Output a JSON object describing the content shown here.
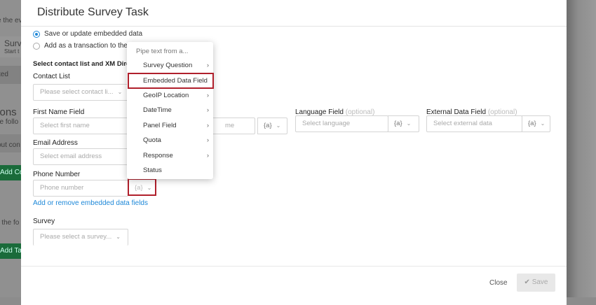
{
  "background": {
    "texts": [
      "e the ev",
      "Surv",
      "Start t",
      "ted",
      "tions",
      "he follo",
      "out con",
      "n the fo"
    ],
    "buttons": [
      "Add Con",
      "Add Tas"
    ]
  },
  "modal": {
    "title": "Distribute Survey Task",
    "radios": [
      {
        "label": "Save or update embedded data",
        "selected": true
      },
      {
        "label": "Add as a transaction to the c",
        "selected": false
      }
    ],
    "section_heading": "Select contact list and XM Direc",
    "contact_list": {
      "label": "Contact List",
      "placeholder": "Please select contact li..."
    },
    "first_name": {
      "label": "First Name Field",
      "placeholder": "Select first name"
    },
    "last_name": {
      "placeholder_partial": "me",
      "pipe": "{a}"
    },
    "language": {
      "label": "Language Field",
      "optional": "(optional)",
      "placeholder": "Select language",
      "pipe": "{a}"
    },
    "external": {
      "label": "External Data Field",
      "optional": "(optional)",
      "placeholder": "Select external data",
      "pipe": "{a}"
    },
    "email": {
      "label": "Email Address",
      "placeholder": "Select email address"
    },
    "phone": {
      "label": "Phone Number",
      "placeholder": "Phone number",
      "pipe": "{a}"
    },
    "embedded_link": "Add or remove embedded data fields",
    "survey": {
      "label": "Survey",
      "placeholder": "Please select a survey..."
    },
    "footer": {
      "close": "Close",
      "save": "Save"
    }
  },
  "pipe_menu": {
    "header": "Pipe text from a...",
    "items": [
      {
        "label": "Survey Question",
        "submenu": true
      },
      {
        "label": "Embedded Data Field",
        "submenu": false,
        "highlighted": true
      },
      {
        "label": "GeoIP Location",
        "submenu": true
      },
      {
        "label": "DateTime",
        "submenu": true
      },
      {
        "label": "Panel Field",
        "submenu": true
      },
      {
        "label": "Quota",
        "submenu": true
      },
      {
        "label": "Response",
        "submenu": true
      },
      {
        "label": "Status",
        "submenu": false
      }
    ]
  },
  "colors": {
    "accent": "#1e88d8",
    "highlight": "#b0202c",
    "green": "#1a6b3a"
  }
}
